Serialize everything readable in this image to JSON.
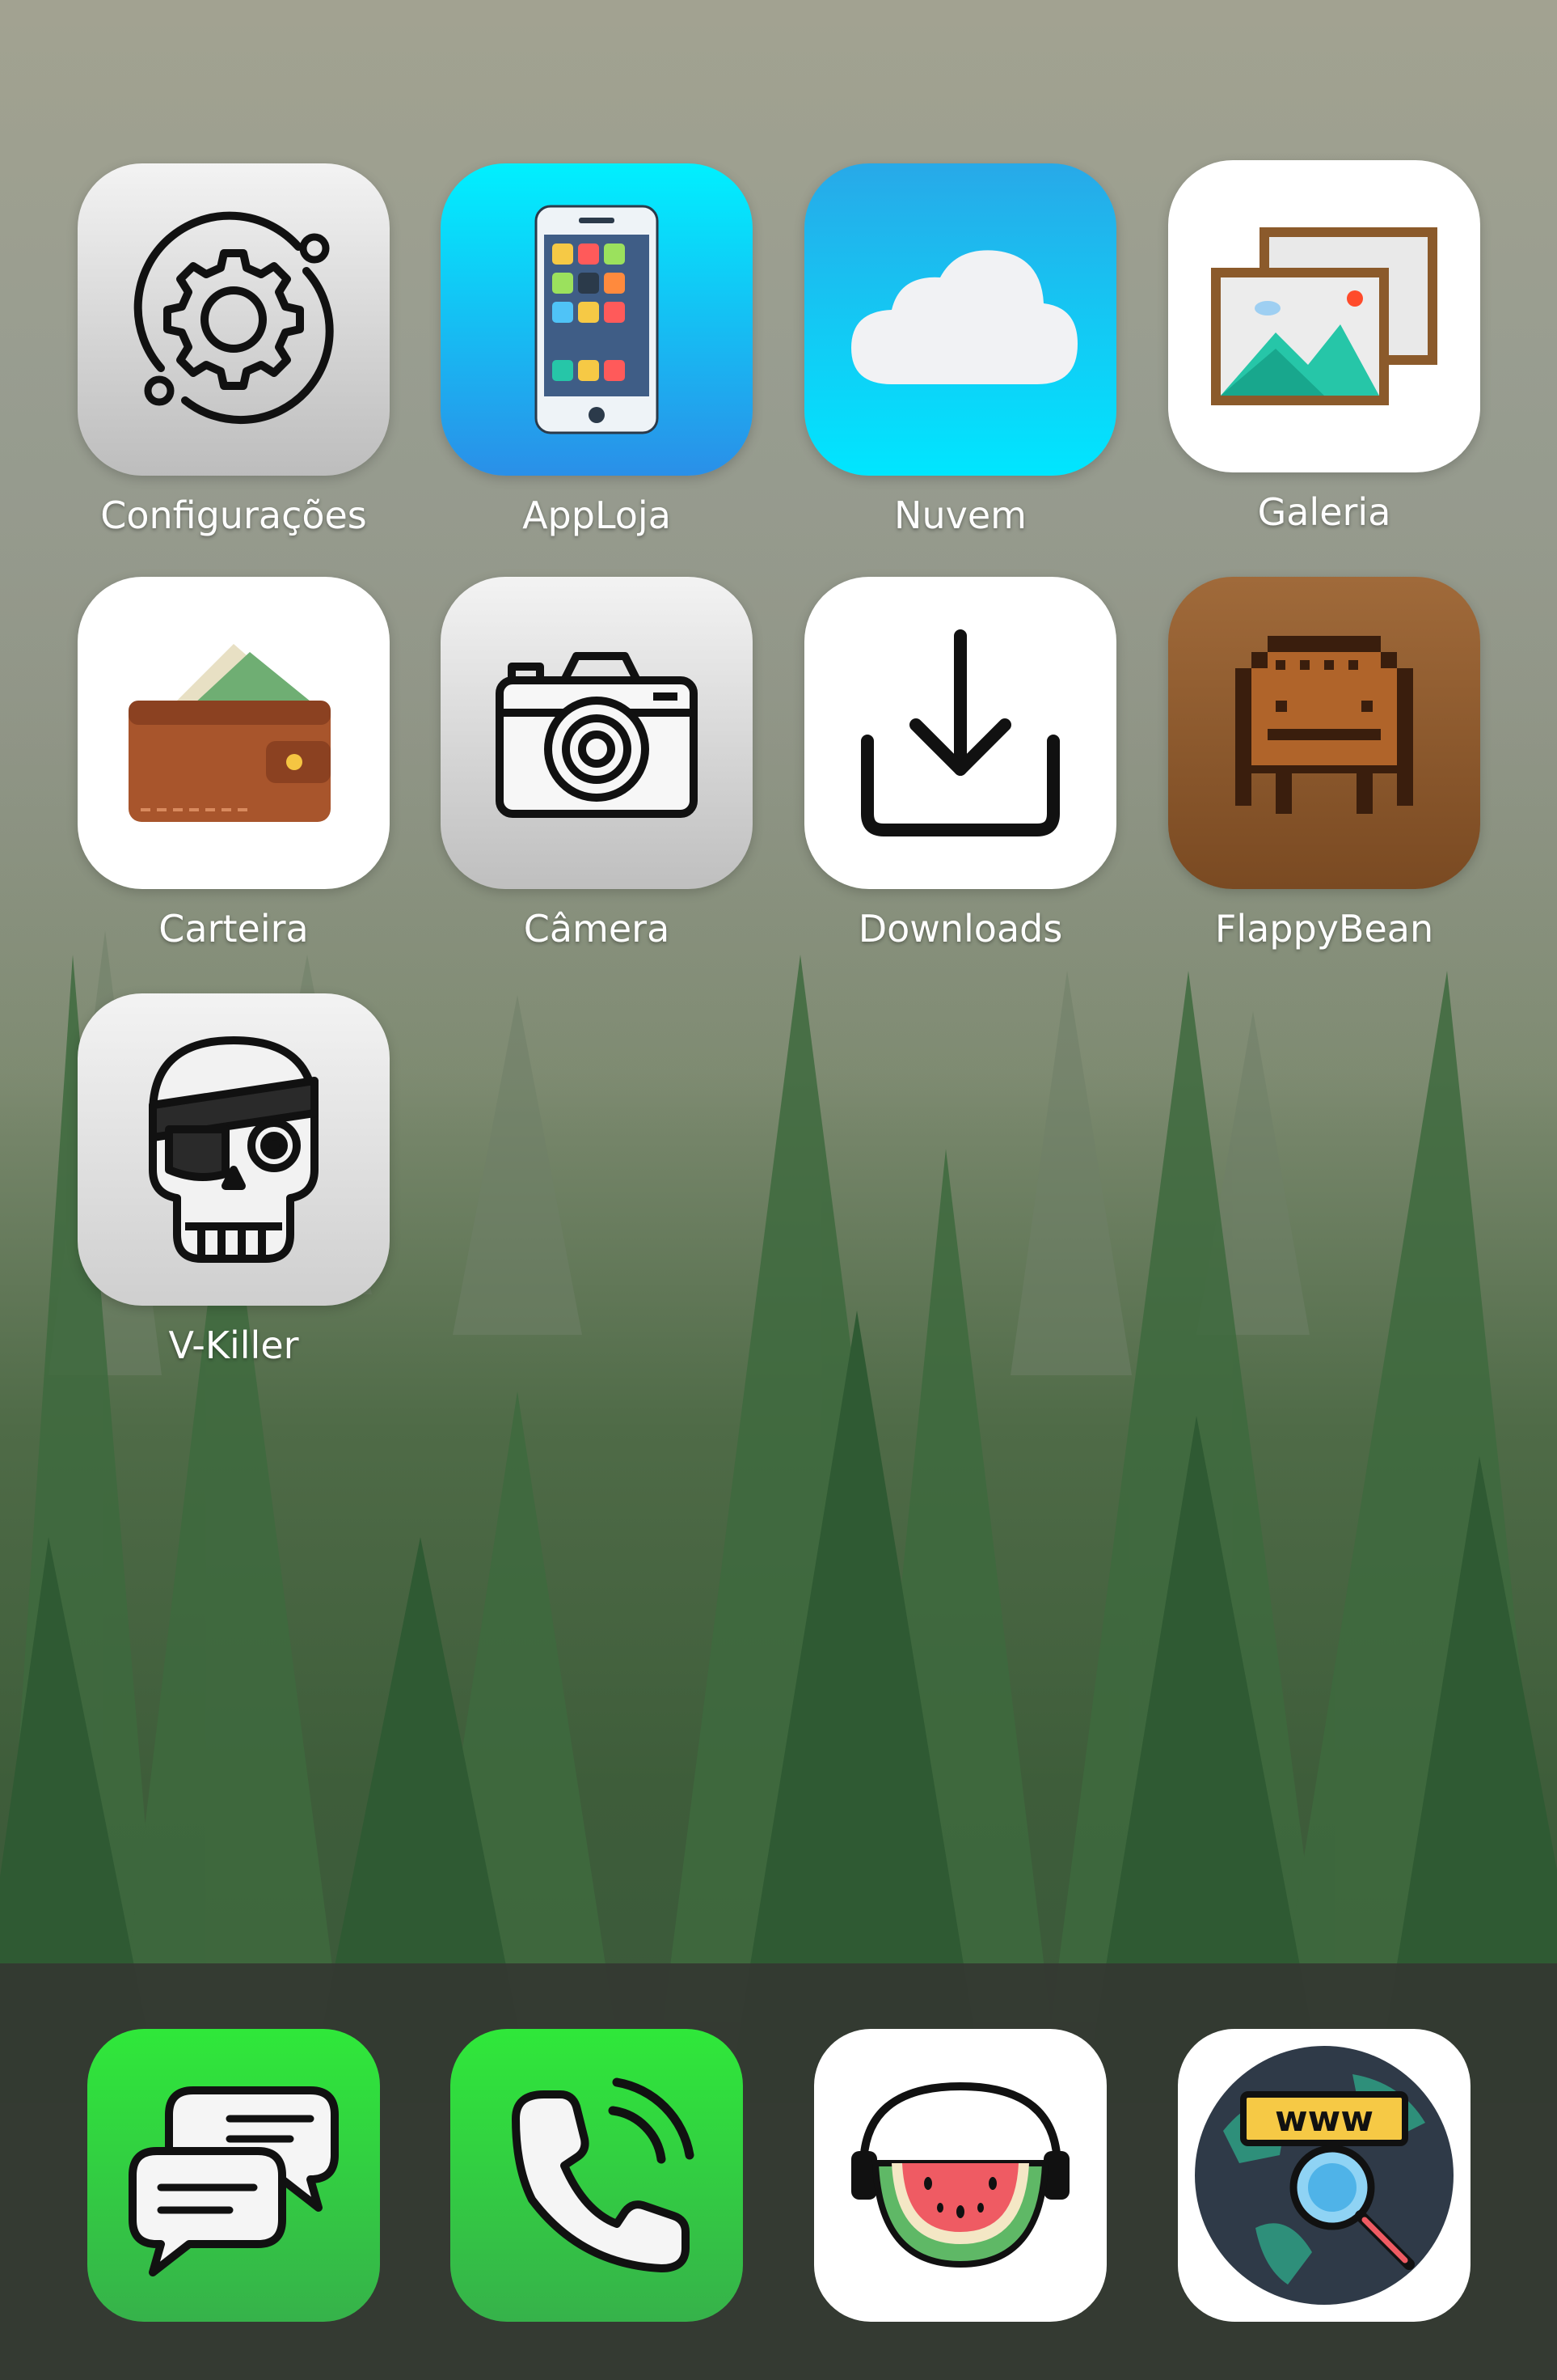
{
  "home_screen": {
    "apps": [
      {
        "id": "settings",
        "label": "Configurações",
        "icon": "gear-orbit-icon"
      },
      {
        "id": "app-store",
        "label": "AppLoja",
        "icon": "smartphone-apps-icon"
      },
      {
        "id": "cloud",
        "label": "Nuvem",
        "icon": "cloud-icon"
      },
      {
        "id": "gallery",
        "label": "Galeria",
        "icon": "photo-frames-icon"
      },
      {
        "id": "wallet",
        "label": "Carteira",
        "icon": "wallet-icon"
      },
      {
        "id": "camera",
        "label": "Câmera",
        "icon": "camera-icon"
      },
      {
        "id": "downloads",
        "label": "Downloads",
        "icon": "download-icon"
      },
      {
        "id": "flappybean",
        "label": "FlappyBean",
        "icon": "pixel-bean-icon"
      },
      {
        "id": "vkiller",
        "label": "V-Killer",
        "icon": "pirate-skull-icon"
      }
    ]
  },
  "dock": {
    "apps": [
      {
        "id": "messages",
        "icon": "chat-bubbles-icon",
        "color": "#2fd23f"
      },
      {
        "id": "phone",
        "icon": "phone-icon",
        "color": "#2fd23f"
      },
      {
        "id": "music",
        "icon": "watermelon-headphones-icon",
        "color": "#ffffff"
      },
      {
        "id": "browser",
        "icon": "globe-www-search-icon",
        "color": "#ffffff"
      }
    ]
  },
  "colors": {
    "appstore_gradient_top": "#00f0ff",
    "appstore_gradient_bottom": "#2a8fe8",
    "cloud_gradient_top": "#28a9e8",
    "cloud_gradient_bottom": "#00e6ff",
    "flappy_brown": "#a06a3a",
    "dock_green": "#2fd23f"
  }
}
